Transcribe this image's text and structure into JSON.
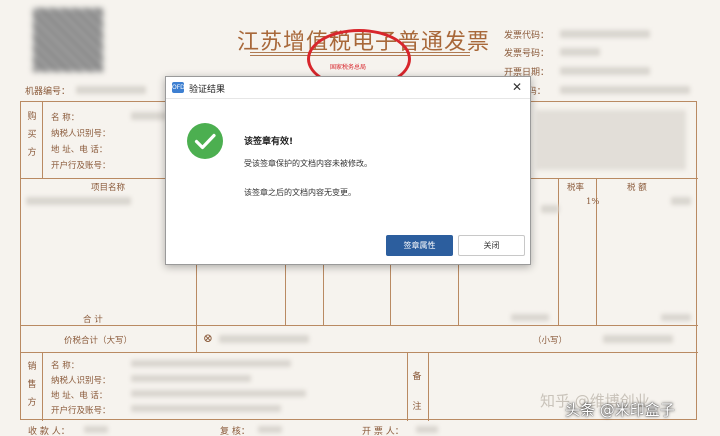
{
  "invoice": {
    "title": "江苏增值税电子普通发票",
    "seal_text": "国家税务总局",
    "meta_labels": [
      "发票代码：",
      "发票号码：",
      "开票日期：",
      "校 验 码："
    ],
    "machine_label": "机器编号：",
    "buyer_side": "购买方",
    "buyer_fields": [
      "名      称：",
      "纳税人识别号：",
      "地 址、电 话：",
      "开户行及账号："
    ],
    "item_header": "项目名称",
    "rate_header": "税率",
    "tax_header": "税    额",
    "rate_value": "1%",
    "total_label": "合        计",
    "total_amount_label": "价税合计（大写）",
    "small_amount_label": "（小写）",
    "seller_side": "销售方",
    "seller_fields": [
      "名      称：",
      "纳税人识别号：",
      "地 址、电 话：",
      "开户行及账号："
    ],
    "remarks_label": "备注",
    "payee_label": "收 款 人：",
    "reviewer_label": "复    核：",
    "issuer_label": "开 票 人："
  },
  "watermark": {
    "text": "知乎 @维博创业",
    "source": "头条 @米印盒子"
  },
  "dialog": {
    "app_icon_text": "OFD",
    "title": "验证结果",
    "heading": "该签章有效!",
    "line1": "受该签章保护的文档内容未被修改。",
    "line2": "该签章之后的文档内容无变更。",
    "primary_button": "签章属性",
    "secondary_button": "关闭",
    "success_color": "#4caf50",
    "primary_color": "#2c5e9e"
  }
}
